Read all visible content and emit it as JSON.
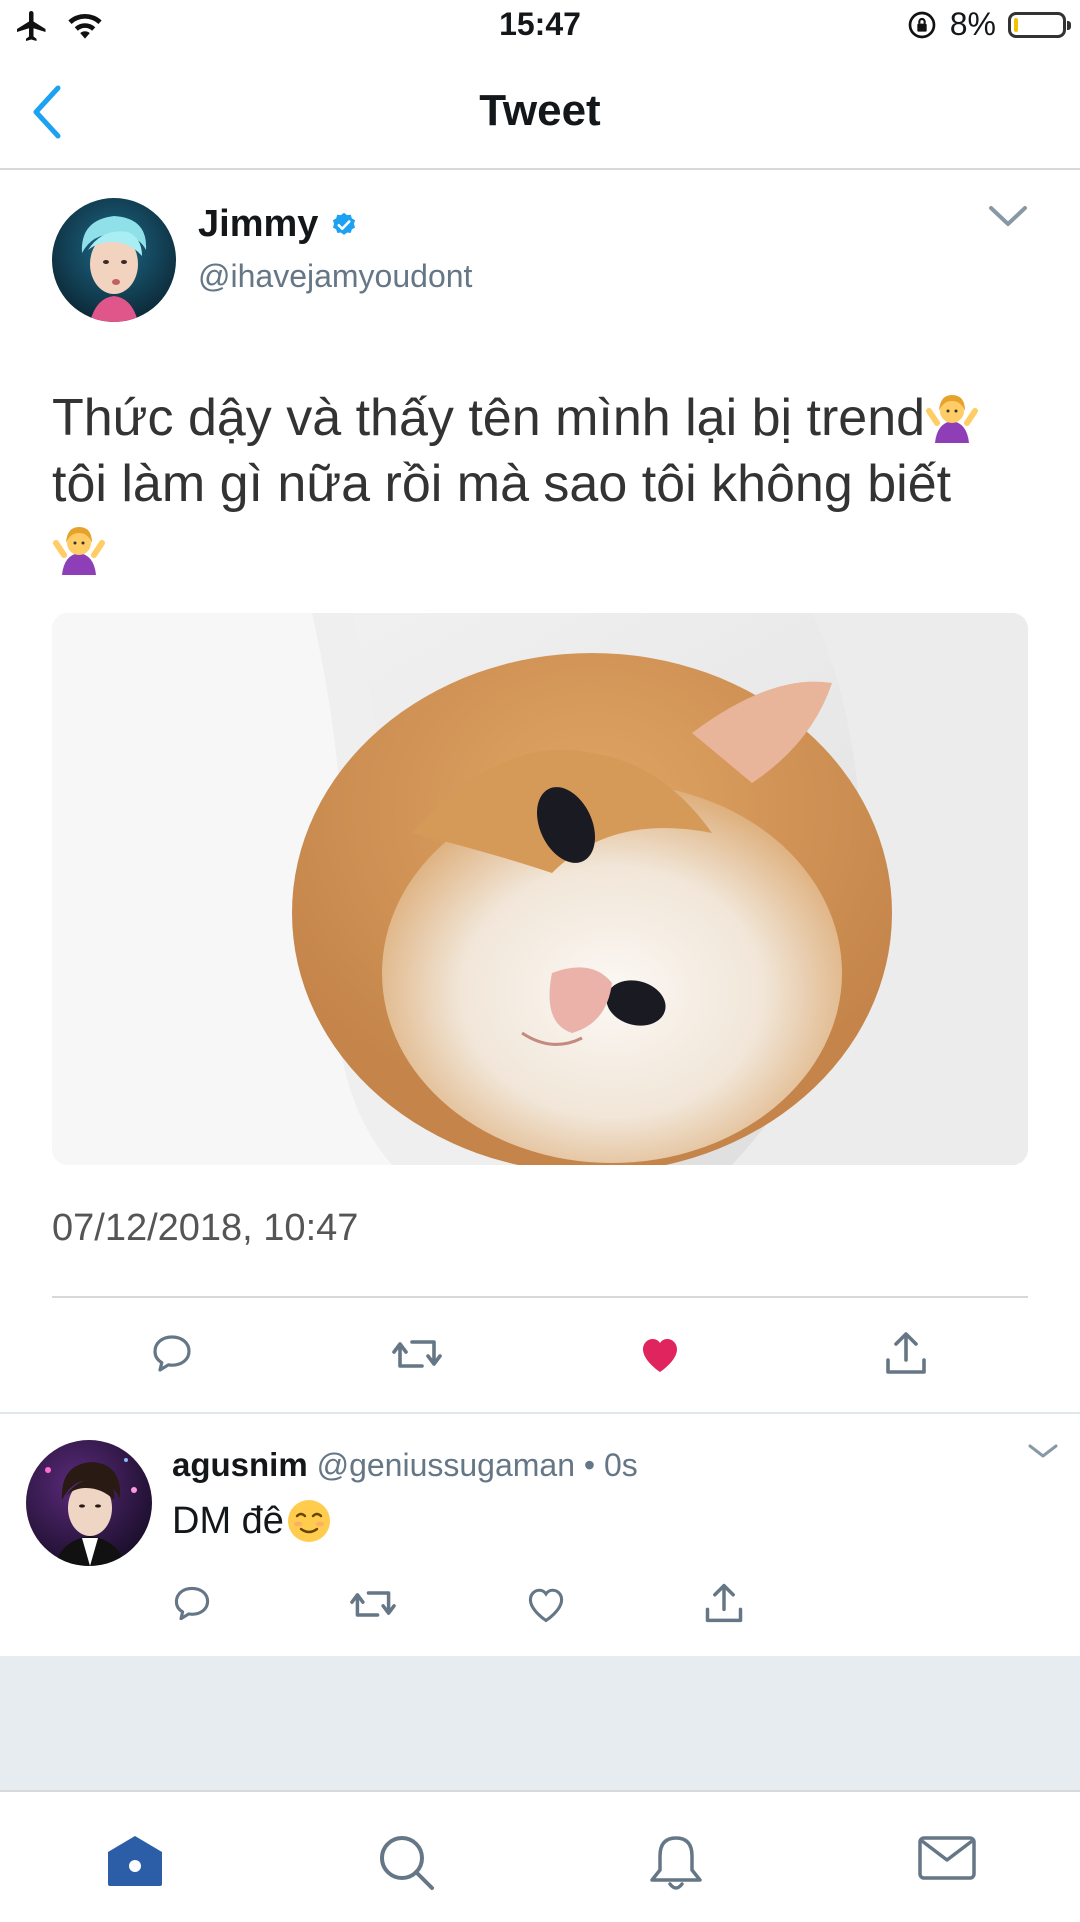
{
  "status_bar": {
    "time": "15:47",
    "battery_text": "8%",
    "battery_level": 0.08,
    "icons": [
      "airplane-icon",
      "wifi-icon",
      "orientation-lock-icon",
      "battery-icon"
    ]
  },
  "nav": {
    "title": "Tweet",
    "back_icon": "chevron-left-icon"
  },
  "tweet": {
    "author_name": "Jimmy",
    "handle": "@ihavejamyoudont",
    "verified": true,
    "text_line1": "Thức dậy và thấy tên mình lại bị trend",
    "text_line2": "tôi làm gì nữa rồi mà sao tôi không biết",
    "emoji": "person-shrugging",
    "media_description": "kitten-photo",
    "timestamp": "07/12/2018, 10:47",
    "liked": true,
    "actions": [
      "reply-icon",
      "retweet-icon",
      "like-icon",
      "share-icon"
    ]
  },
  "reply": {
    "author_name": "agusnim",
    "handle": "@geniussugaman",
    "separator": "•",
    "time": "0s",
    "text": "DM đê",
    "emoji": "relieved-face",
    "actions": [
      "reply-icon",
      "retweet-icon",
      "like-icon",
      "share-icon"
    ]
  },
  "tab_bar": {
    "tabs": [
      "home",
      "search",
      "notifications",
      "messages"
    ],
    "active": "home"
  },
  "colors": {
    "accent": "#1da1f2",
    "like": "#e0245e",
    "secondary_text": "#657786",
    "tab_active": "#2c5ea8"
  }
}
